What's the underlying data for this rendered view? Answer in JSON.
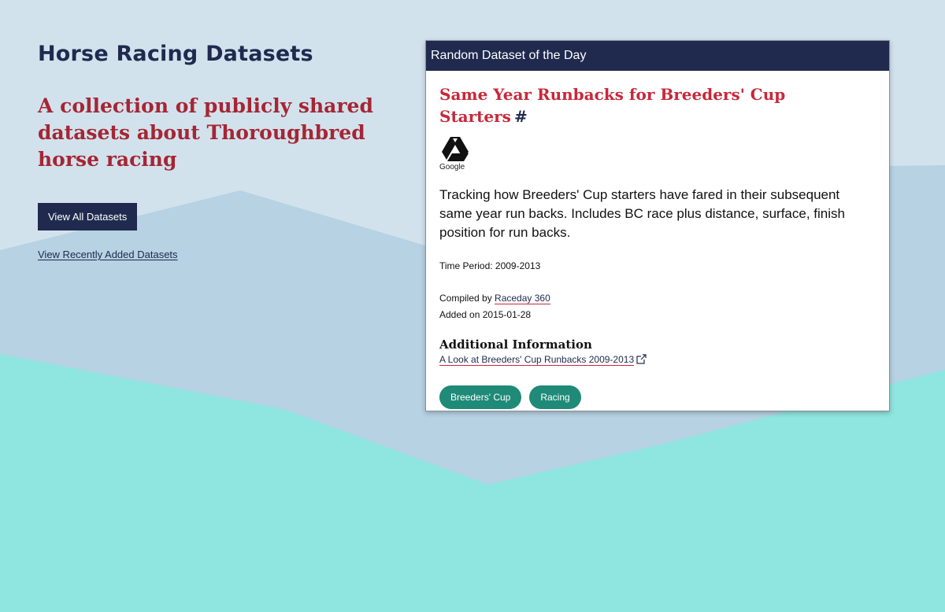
{
  "site": {
    "title": "Horse Racing Datasets",
    "tagline": "A collection of publicly shared datasets about Thoroughbred horse racing",
    "view_all_label": "View All Datasets",
    "view_recent_label": "View Recently Added Datasets"
  },
  "card": {
    "header": "Random Dataset of the Day",
    "title": "Same Year Runbacks for Breeders' Cup Starters",
    "anchor": "#",
    "source_icon": "google-drive-icon",
    "source_label": "Google",
    "description": "Tracking how Breeders' Cup starters have fared in their subsequent same year run backs. Includes BC race plus distance, surface, finish position for run backs.",
    "time_period": "Time Period: 2009-2013",
    "compiled_by_prefix": "Compiled by",
    "compiled_by": "Raceday 360",
    "added_on": "Added on 2015-01-28",
    "additional_heading": "Additional Information",
    "additional_link": "A Look at Breeders' Cup Runbacks 2009-2013",
    "tags": [
      "Breeders' Cup",
      "Racing"
    ]
  },
  "colors": {
    "navy": "#1f2a4e",
    "crimson": "#c8283a",
    "teal": "#1f8a78",
    "sky": "#d2e2ed",
    "mountain": "#b6d2e3",
    "aqua": "#8fe5df"
  }
}
